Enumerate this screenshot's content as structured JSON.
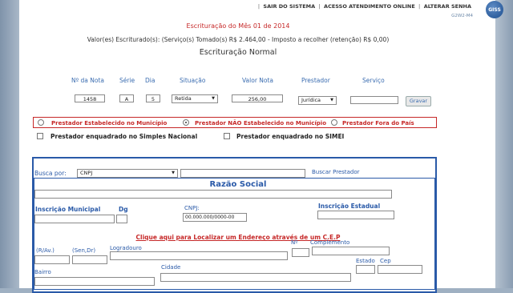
{
  "topnav": {
    "sair": "SAIR DO SISTEMA",
    "acesso": "ACESSO ATENDIMENTO ONLINE",
    "alterar": "ALTERAR SENHA",
    "version": "G2W2-M4",
    "logo": "GISS"
  },
  "header": {
    "title": "Escrituração do Mês 01 de 2014",
    "summary": "Valor(es) Escriturado(s): (Serviço(s) Tomado(s) R$ 2.464,00 - Imposto a recolher (retenção) R$ 0,00)",
    "subtitle": "Escrituração Normal"
  },
  "nota": {
    "headers": {
      "numero": "Nº da Nota",
      "serie": "Série",
      "dia": "Dia",
      "situacao": "Situação",
      "valor": "Valor Nota",
      "prestador": "Prestador",
      "servico": "Serviço"
    },
    "values": {
      "numero": "1458",
      "serie": "A",
      "dia": "5",
      "situacao": "Retida",
      "valor": "256,00",
      "prestador": "Jurídica",
      "servico": ""
    },
    "gravar": "Gravar"
  },
  "prestador_opcoes": {
    "estabelecido": "Prestador Estabelecido no Município",
    "nao_estabelecido": "Prestador NÃO Estabelecido no Município",
    "fora_pais": "Prestador Fora do País",
    "selected": "nao_estabelecido"
  },
  "enquadramento": {
    "simples": "Prestador enquadrado no Simples Nacional",
    "simei": "Prestador enquadrado no SIMEI"
  },
  "busca": {
    "label": "Busca por:",
    "tipo": "CNPJ",
    "valor": "",
    "button": "Buscar Prestador"
  },
  "form": {
    "razao_social_label": "Razão Social",
    "inscricao_municipal_label": "Inscrição Municipal",
    "dg_label": "Dg",
    "cnpj_label": "CNPJ:",
    "cnpj_placeholder": "00.000.000/0000-00",
    "inscricao_estadual_label": "Inscrição Estadual",
    "cep_link": "Clique aqui para Localizar um Endereço através de um C.E.P",
    "ravl_label": "(R/Av.)",
    "sendr_label": "(Sen,Dr)",
    "logradouro_label": "Logradouro",
    "numero_label": "Nº",
    "complemento_label": "Complemento",
    "estado_label": "Estado",
    "cep_label": "Cep",
    "bairro_label": "Bairro",
    "cidade_label": "Cidade"
  }
}
